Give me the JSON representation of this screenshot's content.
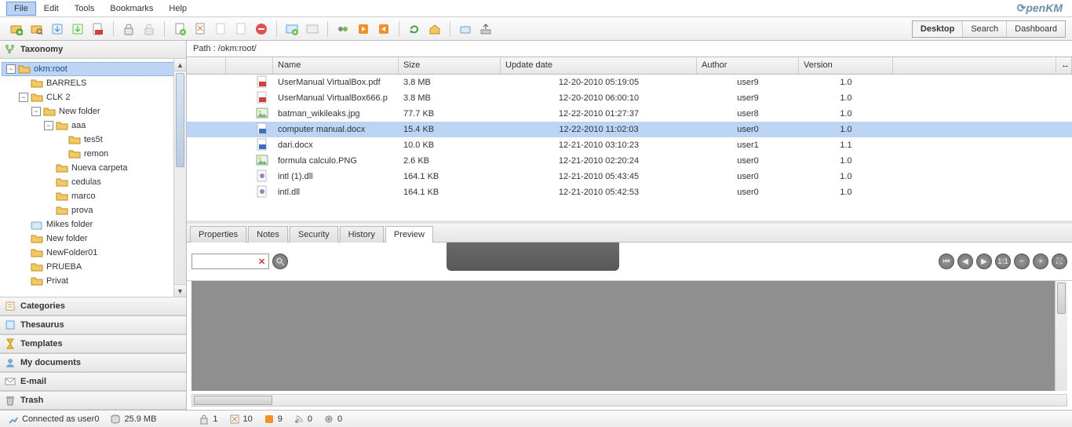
{
  "menu": {
    "items": [
      "File",
      "Edit",
      "Tools",
      "Bookmarks",
      "Help"
    ],
    "activeIndex": 0,
    "logo": "penKM"
  },
  "viewTabs": {
    "items": [
      "Desktop",
      "Search",
      "Dashboard"
    ],
    "activeIndex": 0
  },
  "sidebar": {
    "panels": [
      "Taxonomy",
      "Categories",
      "Thesaurus",
      "Templates",
      "My documents",
      "E-mail",
      "Trash"
    ],
    "tree": {
      "root": "okm:root",
      "nodes": [
        {
          "indent": 1,
          "toggle": "",
          "label": "BARRELS"
        },
        {
          "indent": 1,
          "toggle": "-",
          "label": "CLK 2"
        },
        {
          "indent": 2,
          "toggle": "-",
          "label": "New folder"
        },
        {
          "indent": 3,
          "toggle": "-",
          "label": "aaa"
        },
        {
          "indent": 4,
          "toggle": "",
          "label": "tes5t"
        },
        {
          "indent": 4,
          "toggle": "",
          "label": "remon"
        },
        {
          "indent": 3,
          "toggle": "",
          "label": "Nueva carpeta"
        },
        {
          "indent": 3,
          "toggle": "",
          "label": "cedulas"
        },
        {
          "indent": 3,
          "toggle": "",
          "label": "marco"
        },
        {
          "indent": 3,
          "toggle": "",
          "label": "prova"
        },
        {
          "indent": 1,
          "toggle": "",
          "label": "Mikes folder",
          "closed": true
        },
        {
          "indent": 1,
          "toggle": "",
          "label": "New folder"
        },
        {
          "indent": 1,
          "toggle": "",
          "label": "NewFolder01"
        },
        {
          "indent": 1,
          "toggle": "",
          "label": "PRUEBA"
        },
        {
          "indent": 1,
          "toggle": "",
          "label": "Privat"
        }
      ]
    }
  },
  "path": "Path : /okm:root/",
  "columns": {
    "name": "Name",
    "size": "Size",
    "date": "Update date",
    "author": "Author",
    "version": "Version"
  },
  "files": [
    {
      "icon": "pdf",
      "name": "UserManual VirtualBox.pdf",
      "size": "3.8 MB",
      "date": "12-20-2010 05:19:05",
      "author": "user9",
      "version": "1.0"
    },
    {
      "icon": "pdf",
      "name": "UserManual VirtualBox666.p",
      "size": "3.8 MB",
      "date": "12-20-2010 06:00:10",
      "author": "user9",
      "version": "1.0"
    },
    {
      "icon": "img",
      "name": "batman_wikileaks.jpg",
      "size": "77.7 KB",
      "date": "12-22-2010 01:27:37",
      "author": "user8",
      "version": "1.0"
    },
    {
      "icon": "doc",
      "name": "computer manual.docx",
      "size": "15.4 KB",
      "date": "12-22-2010 11:02:03",
      "author": "user0",
      "version": "1.0",
      "selected": true
    },
    {
      "icon": "doc",
      "name": "dari.docx",
      "size": "10.0 KB",
      "date": "12-21-2010 03:10:23",
      "author": "user1",
      "version": "1.1"
    },
    {
      "icon": "img",
      "name": "formula calculo.PNG",
      "size": "2.6 KB",
      "date": "12-21-2010 02:20:24",
      "author": "user0",
      "version": "1.0"
    },
    {
      "icon": "dll",
      "name": "intl (1).dll",
      "size": "164.1 KB",
      "date": "12-21-2010 05:43:45",
      "author": "user0",
      "version": "1.0"
    },
    {
      "icon": "dll",
      "name": "intl.dll",
      "size": "164.1 KB",
      "date": "12-21-2010 05:42:53",
      "author": "user0",
      "version": "1.0"
    }
  ],
  "detailTabs": {
    "items": [
      "Properties",
      "Notes",
      "Security",
      "History",
      "Preview"
    ],
    "activeIndex": 4
  },
  "status": {
    "connected": "Connected as user0",
    "storage": "25.9 MB",
    "counts": {
      "locked": "1",
      "checked": "10",
      "flagged": "9",
      "subscribed": "0",
      "workflow": "0"
    }
  }
}
